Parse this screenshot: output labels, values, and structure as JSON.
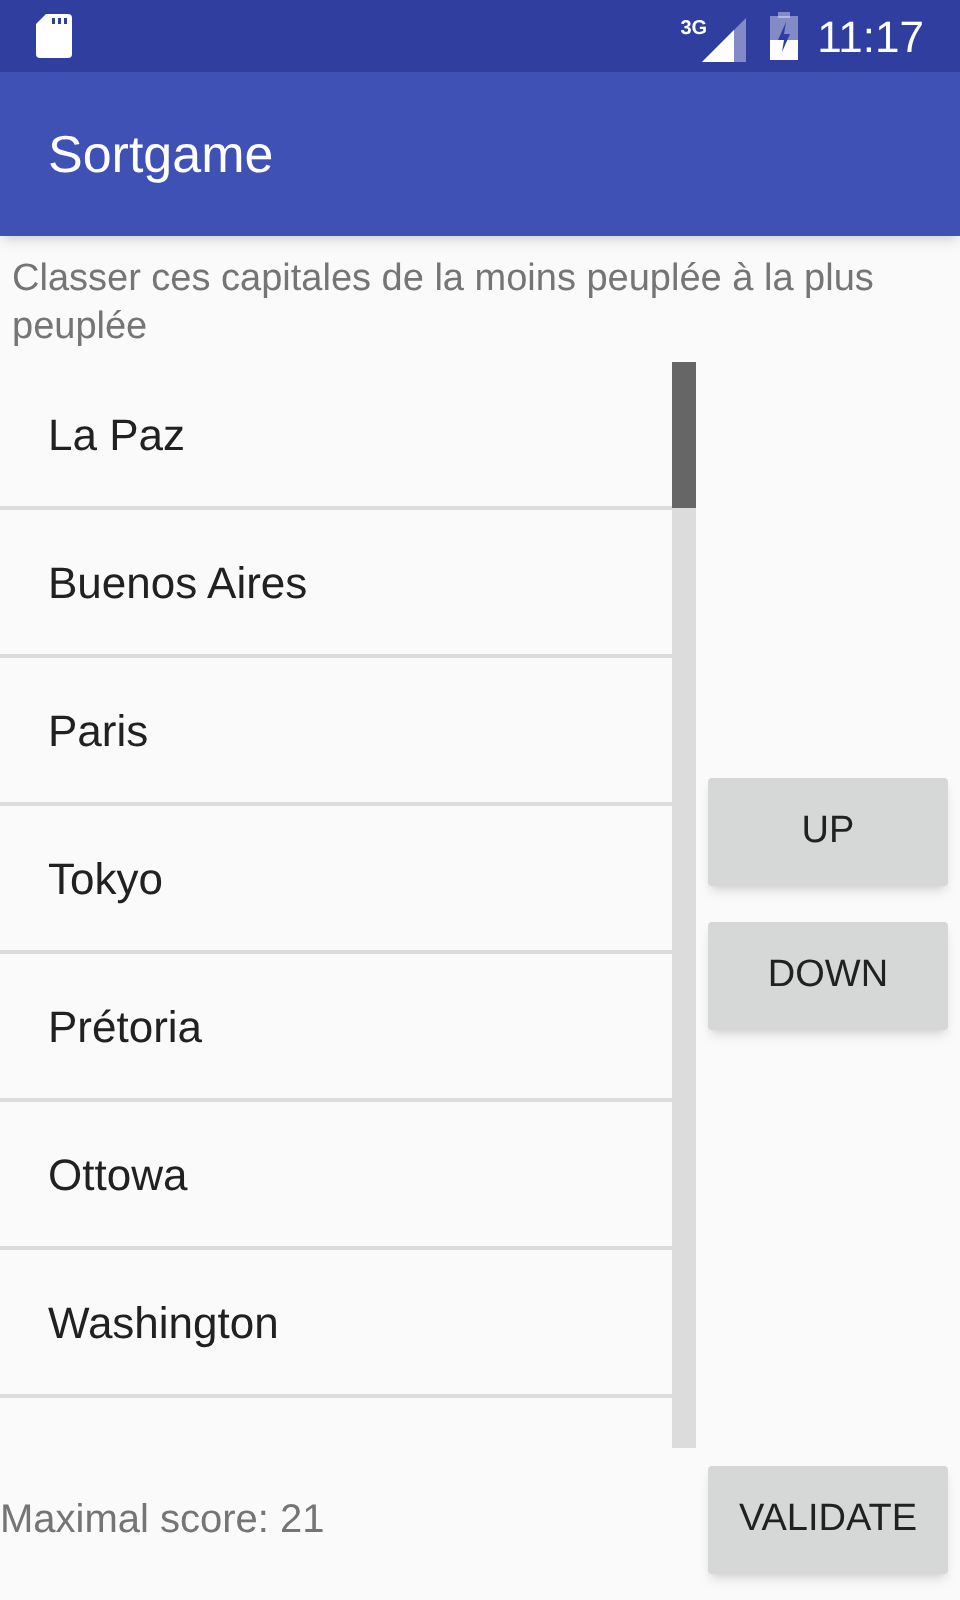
{
  "status_bar": {
    "network": "3G",
    "time": "11:17"
  },
  "app_bar": {
    "title": "Sortgame"
  },
  "instruction": "Classer ces capitales de la moins peuplée à la plus peuplée",
  "list": {
    "items": [
      "La Paz",
      "Buenos Aires",
      "Paris",
      "Tokyo",
      "Prétoria",
      "Ottowa",
      "Washington"
    ]
  },
  "buttons": [
    "UP",
    "DOWN"
  ],
  "footer": {
    "score": "Maximal score: 21",
    "button": "VALIDATE"
  }
}
